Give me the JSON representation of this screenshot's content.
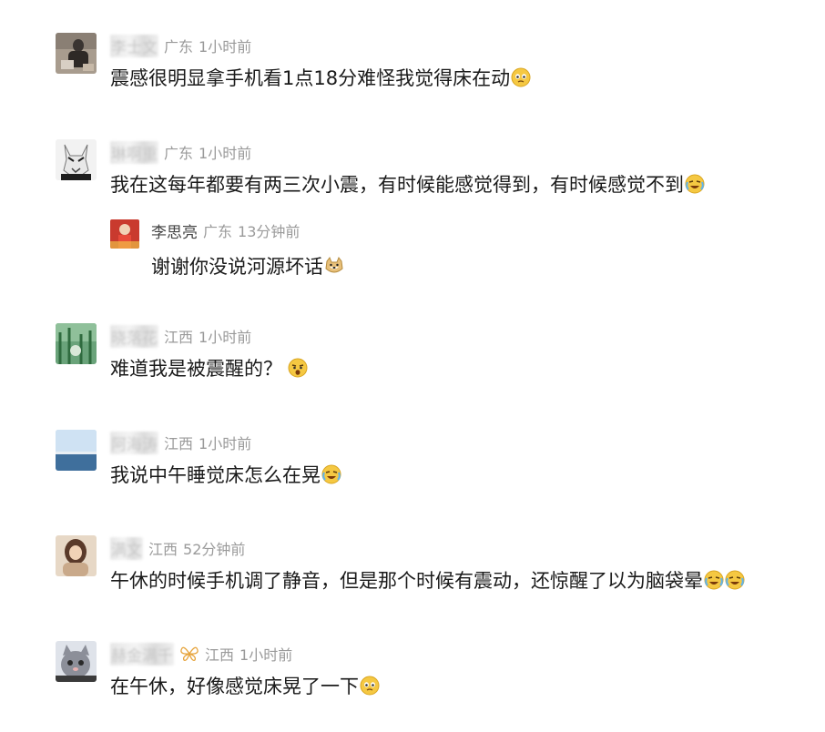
{
  "comments": [
    {
      "username": "李士文",
      "location": "广东",
      "time": "1小时前",
      "content": "震感很明显拿手机看1点18分难怪我觉得床在动",
      "emojis": [
        "sad-face-emoji"
      ]
    },
    {
      "username": "琳啊重",
      "location": "广东",
      "time": "1小时前",
      "content": "我在这每年都要有两三次小震，有时候能感觉得到，有时候感觉不到",
      "emojis": [
        "laugh-cry-emoji"
      ],
      "reply": {
        "username": "李思亮",
        "location": "广东",
        "time": "13分钟前",
        "content": "谢谢你没说河源坏话",
        "emojis": [
          "doge-emoji"
        ]
      }
    },
    {
      "username": "晓落花",
      "location": "江西",
      "time": "1小时前",
      "content": "难道我是被震醒的？",
      "emojis": [
        "shocked-emoji"
      ]
    },
    {
      "username": "阿海涛",
      "location": "江西",
      "time": "1小时前",
      "content": "我说中午睡觉床怎么在晃",
      "emojis": [
        "laugh-cry-emoji"
      ]
    },
    {
      "username": "满文",
      "location": "江西",
      "time": "52分钟前",
      "content": "午休的时候手机调了静音，但是那个时候有震动，还惊醒了以为脑袋晕",
      "emojis": [
        "laugh-cry-emoji",
        "laugh-cry-emoji"
      ]
    },
    {
      "username": "赫金满千",
      "location": "江西",
      "time": "1小时前",
      "content": "在午休，好像感觉床晃了一下",
      "emojis": [
        "sad-face-emoji"
      ],
      "badge": "butterfly-icon"
    }
  ]
}
